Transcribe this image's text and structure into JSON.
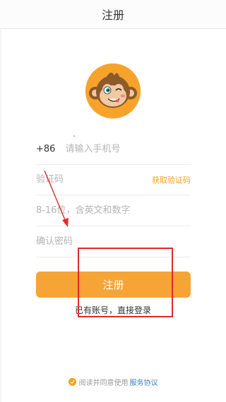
{
  "header": {
    "title": "注册"
  },
  "form": {
    "phone": {
      "prefix": "+86",
      "placeholder": "请输入手机号"
    },
    "code": {
      "placeholder": "验证码",
      "get_code_label": "获取验证码"
    },
    "password": {
      "placeholder": "8-16位，含英文和数字"
    },
    "confirm": {
      "placeholder": "确认密码"
    }
  },
  "actions": {
    "register_label": "注册",
    "login_link": "已有账号，直接登录"
  },
  "agreement": {
    "text": "阅读并同意使用",
    "link": "服务协议"
  },
  "colors": {
    "accent": "#f7a436",
    "link": "#3a7ecb",
    "annotation": "#e22a2a"
  },
  "icons": {
    "avatar": "monkey-mascot",
    "check": "check-circle-icon"
  }
}
